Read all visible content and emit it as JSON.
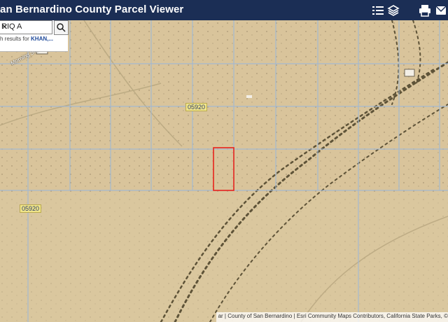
{
  "header": {
    "title": "an Bernardino County Parcel Viewer",
    "icons": [
      "layers-list-icon",
      "basemap-stack-icon",
      "print-icon",
      "share-icon"
    ]
  },
  "search": {
    "value": "RIQ A",
    "hint_prefix": "h results for ",
    "hint_bold": "KHAN,..."
  },
  "map_labels": {
    "street": "Morning Star Rd",
    "parcel_a": "05920",
    "parcel_b": "05920"
  },
  "attribution": "ar | County of San Bernardino | Esri Community Maps Contributors, California State Parks, ©",
  "colors": {
    "header_bg": "#1b2e55",
    "parcel_lines": "#9fb8d6",
    "selected_parcel": "#e8231c",
    "terrain": "#d8c39a"
  }
}
